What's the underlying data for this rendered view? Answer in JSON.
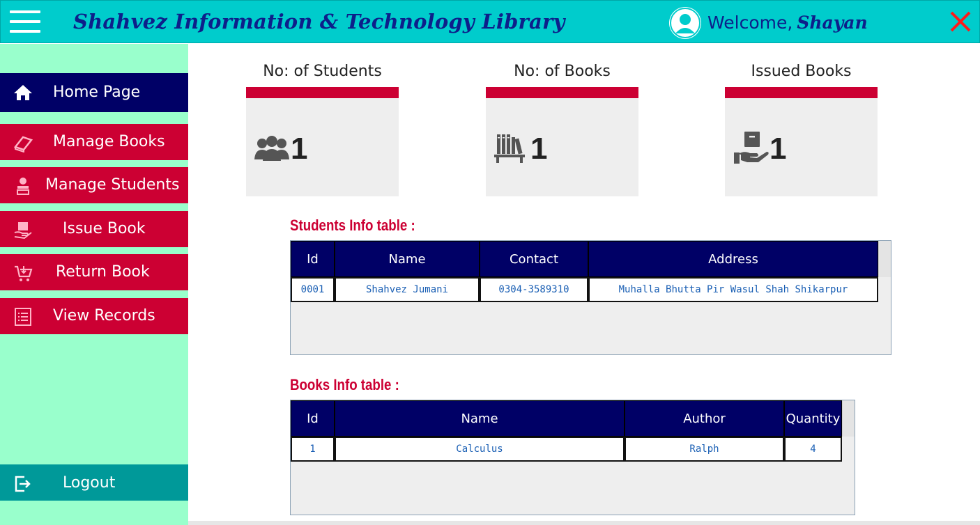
{
  "header": {
    "title": "Shahvez Information & Technology Library",
    "welcome_label": "Welcome,",
    "username": "Shayan",
    "bg_color": "#00cccc"
  },
  "sidebar": {
    "items": [
      {
        "label": "Home Page",
        "icon": "home-icon",
        "active": true
      },
      {
        "label": "Manage Books",
        "icon": "book-icon"
      },
      {
        "label": "Manage Students",
        "icon": "student-icon"
      },
      {
        "label": "Issue Book",
        "icon": "issue-book-icon"
      },
      {
        "label": "Return Book",
        "icon": "return-cart-icon"
      },
      {
        "label": "View Records",
        "icon": "list-icon"
      }
    ],
    "logout_label": "Logout",
    "active_color": "#000066",
    "item_color": "#cc0033"
  },
  "stats": [
    {
      "title": "No: of Students",
      "value": "1",
      "icon": "users-icon"
    },
    {
      "title": "No: of Books",
      "value": "1",
      "icon": "bookshelf-icon"
    },
    {
      "title": "Issued Books",
      "value": "1",
      "icon": "hand-box-icon"
    }
  ],
  "students_table": {
    "title": "Students Info table :",
    "columns": [
      "Id",
      "Name",
      "Contact",
      "Address"
    ],
    "rows": [
      [
        "0001",
        "Shahvez Jumani",
        "0304-3589310",
        "Muhalla Bhutta Pir Wasul Shah Shikarpur"
      ]
    ]
  },
  "books_table": {
    "title": "Books Info table :",
    "columns": [
      "Id",
      "Name",
      "Author",
      "Quantity"
    ],
    "rows": [
      [
        "1",
        "Calculus",
        "Ralph",
        "4"
      ]
    ]
  }
}
